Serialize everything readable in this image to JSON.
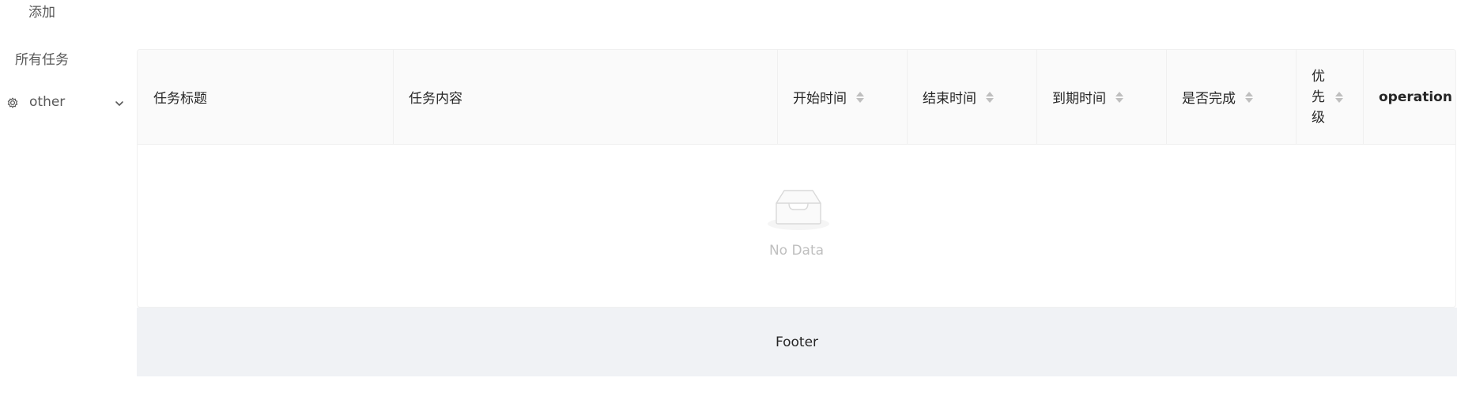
{
  "sidebar": {
    "items": [
      {
        "label": "添加"
      },
      {
        "label": "所有任务"
      }
    ],
    "submenu": {
      "label": "other",
      "icon": "gear-icon",
      "expand_icon": "chevron-down-icon"
    }
  },
  "table": {
    "columns": [
      {
        "title": "任务标题",
        "sortable": false
      },
      {
        "title": "任务内容",
        "sortable": false
      },
      {
        "title": "开始时间",
        "sortable": true
      },
      {
        "title": "结束时间",
        "sortable": true
      },
      {
        "title": "到期时间",
        "sortable": true
      },
      {
        "title": "是否完成",
        "sortable": true
      },
      {
        "title": "优先级",
        "sortable": true
      },
      {
        "title": "operation",
        "sortable": false
      }
    ],
    "rows": [],
    "empty_text": "No Data"
  },
  "footer": {
    "text": "Footer"
  }
}
